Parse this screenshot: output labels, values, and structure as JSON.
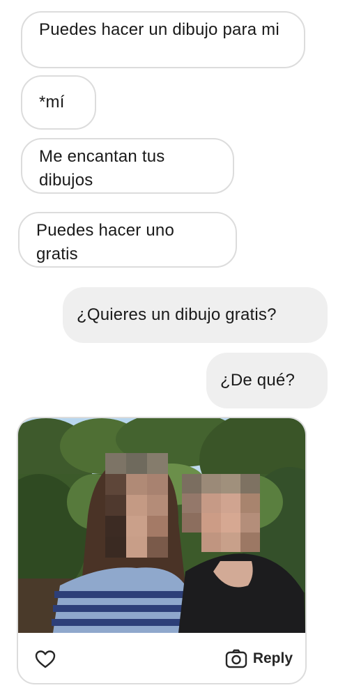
{
  "messages": [
    {
      "direction": "incoming",
      "text": "Puedes hacer un dibujo para mi"
    },
    {
      "direction": "incoming",
      "text": "*mí"
    },
    {
      "direction": "incoming",
      "text": "Me encantan tus dibujos"
    },
    {
      "direction": "incoming",
      "text": "Puedes hacer uno gratis"
    },
    {
      "direction": "outgoing",
      "text": "¿Quieres un dibujo gratis?"
    },
    {
      "direction": "outgoing",
      "text": "¿De qué?"
    }
  ],
  "photo_message": {
    "icons": {
      "like": "heart-icon",
      "reply": "camera-icon"
    },
    "reply_label": "Reply"
  },
  "colors": {
    "incoming_bubble_border": "#dcdcdc",
    "outgoing_bubble_bg": "#efefef",
    "text": "#1a1a1a"
  }
}
